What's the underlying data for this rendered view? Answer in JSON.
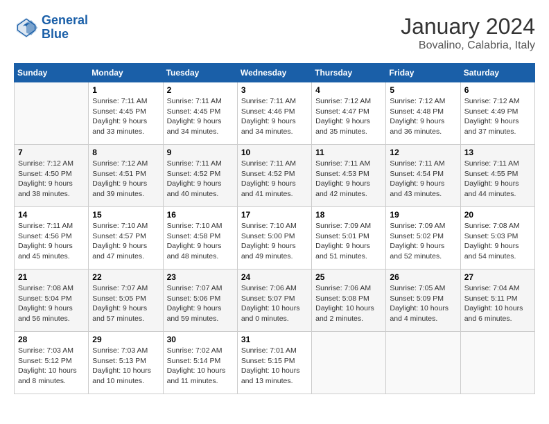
{
  "logo": {
    "line1": "General",
    "line2": "Blue"
  },
  "title": "January 2024",
  "subtitle": "Bovalino, Calabria, Italy",
  "days_header": [
    "Sunday",
    "Monday",
    "Tuesday",
    "Wednesday",
    "Thursday",
    "Friday",
    "Saturday"
  ],
  "weeks": [
    [
      {
        "num": "",
        "info": ""
      },
      {
        "num": "1",
        "info": "Sunrise: 7:11 AM\nSunset: 4:45 PM\nDaylight: 9 hours\nand 33 minutes."
      },
      {
        "num": "2",
        "info": "Sunrise: 7:11 AM\nSunset: 4:45 PM\nDaylight: 9 hours\nand 34 minutes."
      },
      {
        "num": "3",
        "info": "Sunrise: 7:11 AM\nSunset: 4:46 PM\nDaylight: 9 hours\nand 34 minutes."
      },
      {
        "num": "4",
        "info": "Sunrise: 7:12 AM\nSunset: 4:47 PM\nDaylight: 9 hours\nand 35 minutes."
      },
      {
        "num": "5",
        "info": "Sunrise: 7:12 AM\nSunset: 4:48 PM\nDaylight: 9 hours\nand 36 minutes."
      },
      {
        "num": "6",
        "info": "Sunrise: 7:12 AM\nSunset: 4:49 PM\nDaylight: 9 hours\nand 37 minutes."
      }
    ],
    [
      {
        "num": "7",
        "info": "Sunrise: 7:12 AM\nSunset: 4:50 PM\nDaylight: 9 hours\nand 38 minutes."
      },
      {
        "num": "8",
        "info": "Sunrise: 7:12 AM\nSunset: 4:51 PM\nDaylight: 9 hours\nand 39 minutes."
      },
      {
        "num": "9",
        "info": "Sunrise: 7:11 AM\nSunset: 4:52 PM\nDaylight: 9 hours\nand 40 minutes."
      },
      {
        "num": "10",
        "info": "Sunrise: 7:11 AM\nSunset: 4:52 PM\nDaylight: 9 hours\nand 41 minutes."
      },
      {
        "num": "11",
        "info": "Sunrise: 7:11 AM\nSunset: 4:53 PM\nDaylight: 9 hours\nand 42 minutes."
      },
      {
        "num": "12",
        "info": "Sunrise: 7:11 AM\nSunset: 4:54 PM\nDaylight: 9 hours\nand 43 minutes."
      },
      {
        "num": "13",
        "info": "Sunrise: 7:11 AM\nSunset: 4:55 PM\nDaylight: 9 hours\nand 44 minutes."
      }
    ],
    [
      {
        "num": "14",
        "info": "Sunrise: 7:11 AM\nSunset: 4:56 PM\nDaylight: 9 hours\nand 45 minutes."
      },
      {
        "num": "15",
        "info": "Sunrise: 7:10 AM\nSunset: 4:57 PM\nDaylight: 9 hours\nand 47 minutes."
      },
      {
        "num": "16",
        "info": "Sunrise: 7:10 AM\nSunset: 4:58 PM\nDaylight: 9 hours\nand 48 minutes."
      },
      {
        "num": "17",
        "info": "Sunrise: 7:10 AM\nSunset: 5:00 PM\nDaylight: 9 hours\nand 49 minutes."
      },
      {
        "num": "18",
        "info": "Sunrise: 7:09 AM\nSunset: 5:01 PM\nDaylight: 9 hours\nand 51 minutes."
      },
      {
        "num": "19",
        "info": "Sunrise: 7:09 AM\nSunset: 5:02 PM\nDaylight: 9 hours\nand 52 minutes."
      },
      {
        "num": "20",
        "info": "Sunrise: 7:08 AM\nSunset: 5:03 PM\nDaylight: 9 hours\nand 54 minutes."
      }
    ],
    [
      {
        "num": "21",
        "info": "Sunrise: 7:08 AM\nSunset: 5:04 PM\nDaylight: 9 hours\nand 56 minutes."
      },
      {
        "num": "22",
        "info": "Sunrise: 7:07 AM\nSunset: 5:05 PM\nDaylight: 9 hours\nand 57 minutes."
      },
      {
        "num": "23",
        "info": "Sunrise: 7:07 AM\nSunset: 5:06 PM\nDaylight: 9 hours\nand 59 minutes."
      },
      {
        "num": "24",
        "info": "Sunrise: 7:06 AM\nSunset: 5:07 PM\nDaylight: 10 hours\nand 0 minutes."
      },
      {
        "num": "25",
        "info": "Sunrise: 7:06 AM\nSunset: 5:08 PM\nDaylight: 10 hours\nand 2 minutes."
      },
      {
        "num": "26",
        "info": "Sunrise: 7:05 AM\nSunset: 5:09 PM\nDaylight: 10 hours\nand 4 minutes."
      },
      {
        "num": "27",
        "info": "Sunrise: 7:04 AM\nSunset: 5:11 PM\nDaylight: 10 hours\nand 6 minutes."
      }
    ],
    [
      {
        "num": "28",
        "info": "Sunrise: 7:03 AM\nSunset: 5:12 PM\nDaylight: 10 hours\nand 8 minutes."
      },
      {
        "num": "29",
        "info": "Sunrise: 7:03 AM\nSunset: 5:13 PM\nDaylight: 10 hours\nand 10 minutes."
      },
      {
        "num": "30",
        "info": "Sunrise: 7:02 AM\nSunset: 5:14 PM\nDaylight: 10 hours\nand 11 minutes."
      },
      {
        "num": "31",
        "info": "Sunrise: 7:01 AM\nSunset: 5:15 PM\nDaylight: 10 hours\nand 13 minutes."
      },
      {
        "num": "",
        "info": ""
      },
      {
        "num": "",
        "info": ""
      },
      {
        "num": "",
        "info": ""
      }
    ]
  ]
}
